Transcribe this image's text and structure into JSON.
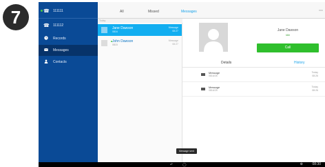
{
  "step_badge": "7",
  "sidebar": {
    "accounts": [
      {
        "label": "111111",
        "icon": "phone-handset-icon",
        "online": true
      },
      {
        "label": "111112",
        "icon": "phone-handset-icon",
        "online": false
      }
    ],
    "items": [
      {
        "label": "Records",
        "icon": "clock-icon",
        "active": false
      },
      {
        "label": "Messages",
        "icon": "envelope-icon",
        "active": true
      },
      {
        "label": "Contacts",
        "icon": "person-icon",
        "active": false
      }
    ]
  },
  "tabs": [
    {
      "label": "All",
      "active": false
    },
    {
      "label": "Missed",
      "active": false
    },
    {
      "label": "Messages",
      "active": true
    }
  ],
  "more_icon": "⋯",
  "list": {
    "section": "Today",
    "rows": [
      {
        "name": "Jane Dawson",
        "sub": "0816",
        "time": "Message",
        "time2": "08:27",
        "selected": true,
        "online": false
      },
      {
        "name": "John Dawson",
        "sub": "0815",
        "time": "Message",
        "time2": "08:27",
        "selected": false,
        "online": true
      }
    ]
  },
  "contact": {
    "name": "Jane Dawson",
    "status": "Idle",
    "call_label": "Call"
  },
  "pane_tabs": {
    "details": "Details",
    "history": "History"
  },
  "messages": [
    {
      "title": "Message",
      "number": "0816/26",
      "time": "Today",
      "time2": "08:26"
    },
    {
      "title": "Message",
      "number": "0816/25",
      "time": "Today",
      "time2": "08:26"
    }
  ],
  "toast": "Message sent",
  "system_bar": {
    "back": "↶",
    "home": "◯",
    "status": "⊕",
    "clock": "08:30"
  },
  "colors": {
    "sidebar": "#0a4a96",
    "accent": "#12aef0",
    "call_button": "#2fbf2d"
  }
}
